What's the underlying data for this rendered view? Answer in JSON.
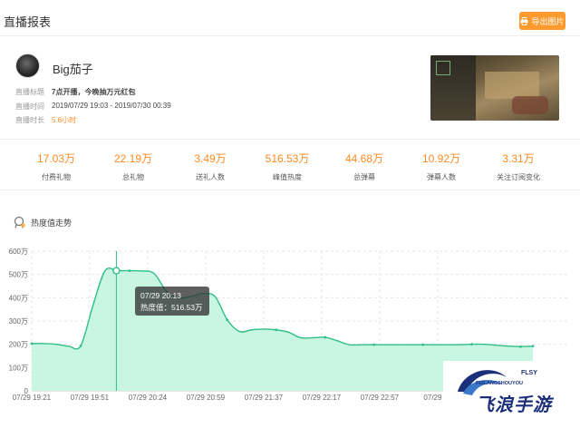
{
  "header": {
    "title": "直播报表",
    "export_label": "导出图片"
  },
  "streamer": {
    "name": "Big茄子",
    "info": [
      {
        "label": "直播标题",
        "value": "7点开播，今晚抽万元红包"
      },
      {
        "label": "直播时间",
        "value": "2019/07/29 19:03 - 2019/07/30 00:39"
      },
      {
        "label": "直播时长",
        "value": "5.6小时"
      }
    ]
  },
  "stats": [
    {
      "value": "17.03万",
      "label": "付费礼物"
    },
    {
      "value": "22.19万",
      "label": "总礼物"
    },
    {
      "value": "3.49万",
      "label": "送礼人数"
    },
    {
      "value": "516.53万",
      "label": "峰值热度"
    },
    {
      "value": "44.68万",
      "label": "总弹幕"
    },
    {
      "value": "10.92万",
      "label": "弹幕人数"
    },
    {
      "value": "3.31万",
      "label": "关注订阅变化"
    }
  ],
  "trend": {
    "title": "热度值走势"
  },
  "tooltip": {
    "time": "07/29 20:13",
    "label": "热度值：516.53万"
  },
  "watermark": {
    "brand": "飞浪手游",
    "domain": "FEILANGSHOUYOU",
    "tag": "FLSY"
  },
  "colors": {
    "accent": "#ff8a1f",
    "button": "#ff9a2e",
    "line": "#2ebf88",
    "area": "#c6f5e1"
  },
  "chart_data": {
    "type": "area",
    "yticks": [
      "0",
      "100万",
      "200万",
      "300万",
      "400万",
      "500万",
      "600万"
    ],
    "ylim": [
      0,
      600
    ],
    "xticks": [
      "07/29 19:21",
      "07/29 19:51",
      "07/29 20:24",
      "07/29 20:59",
      "07/29 21:37",
      "07/29 22:17",
      "07/29 22:57",
      "07/29 23"
    ],
    "series": [
      {
        "values": [
          203,
          203,
          200,
          192,
          193,
          365,
          516,
          516,
          516,
          515,
          505,
          430,
          400,
          405,
          418,
          405,
          305,
          255,
          262,
          265,
          262,
          252,
          228,
          228,
          230,
          215,
          198,
          198,
          198,
          198,
          198,
          198,
          198,
          198,
          198,
          198,
          200,
          200,
          196,
          192,
          190,
          192
        ]
      }
    ],
    "grid": true
  }
}
